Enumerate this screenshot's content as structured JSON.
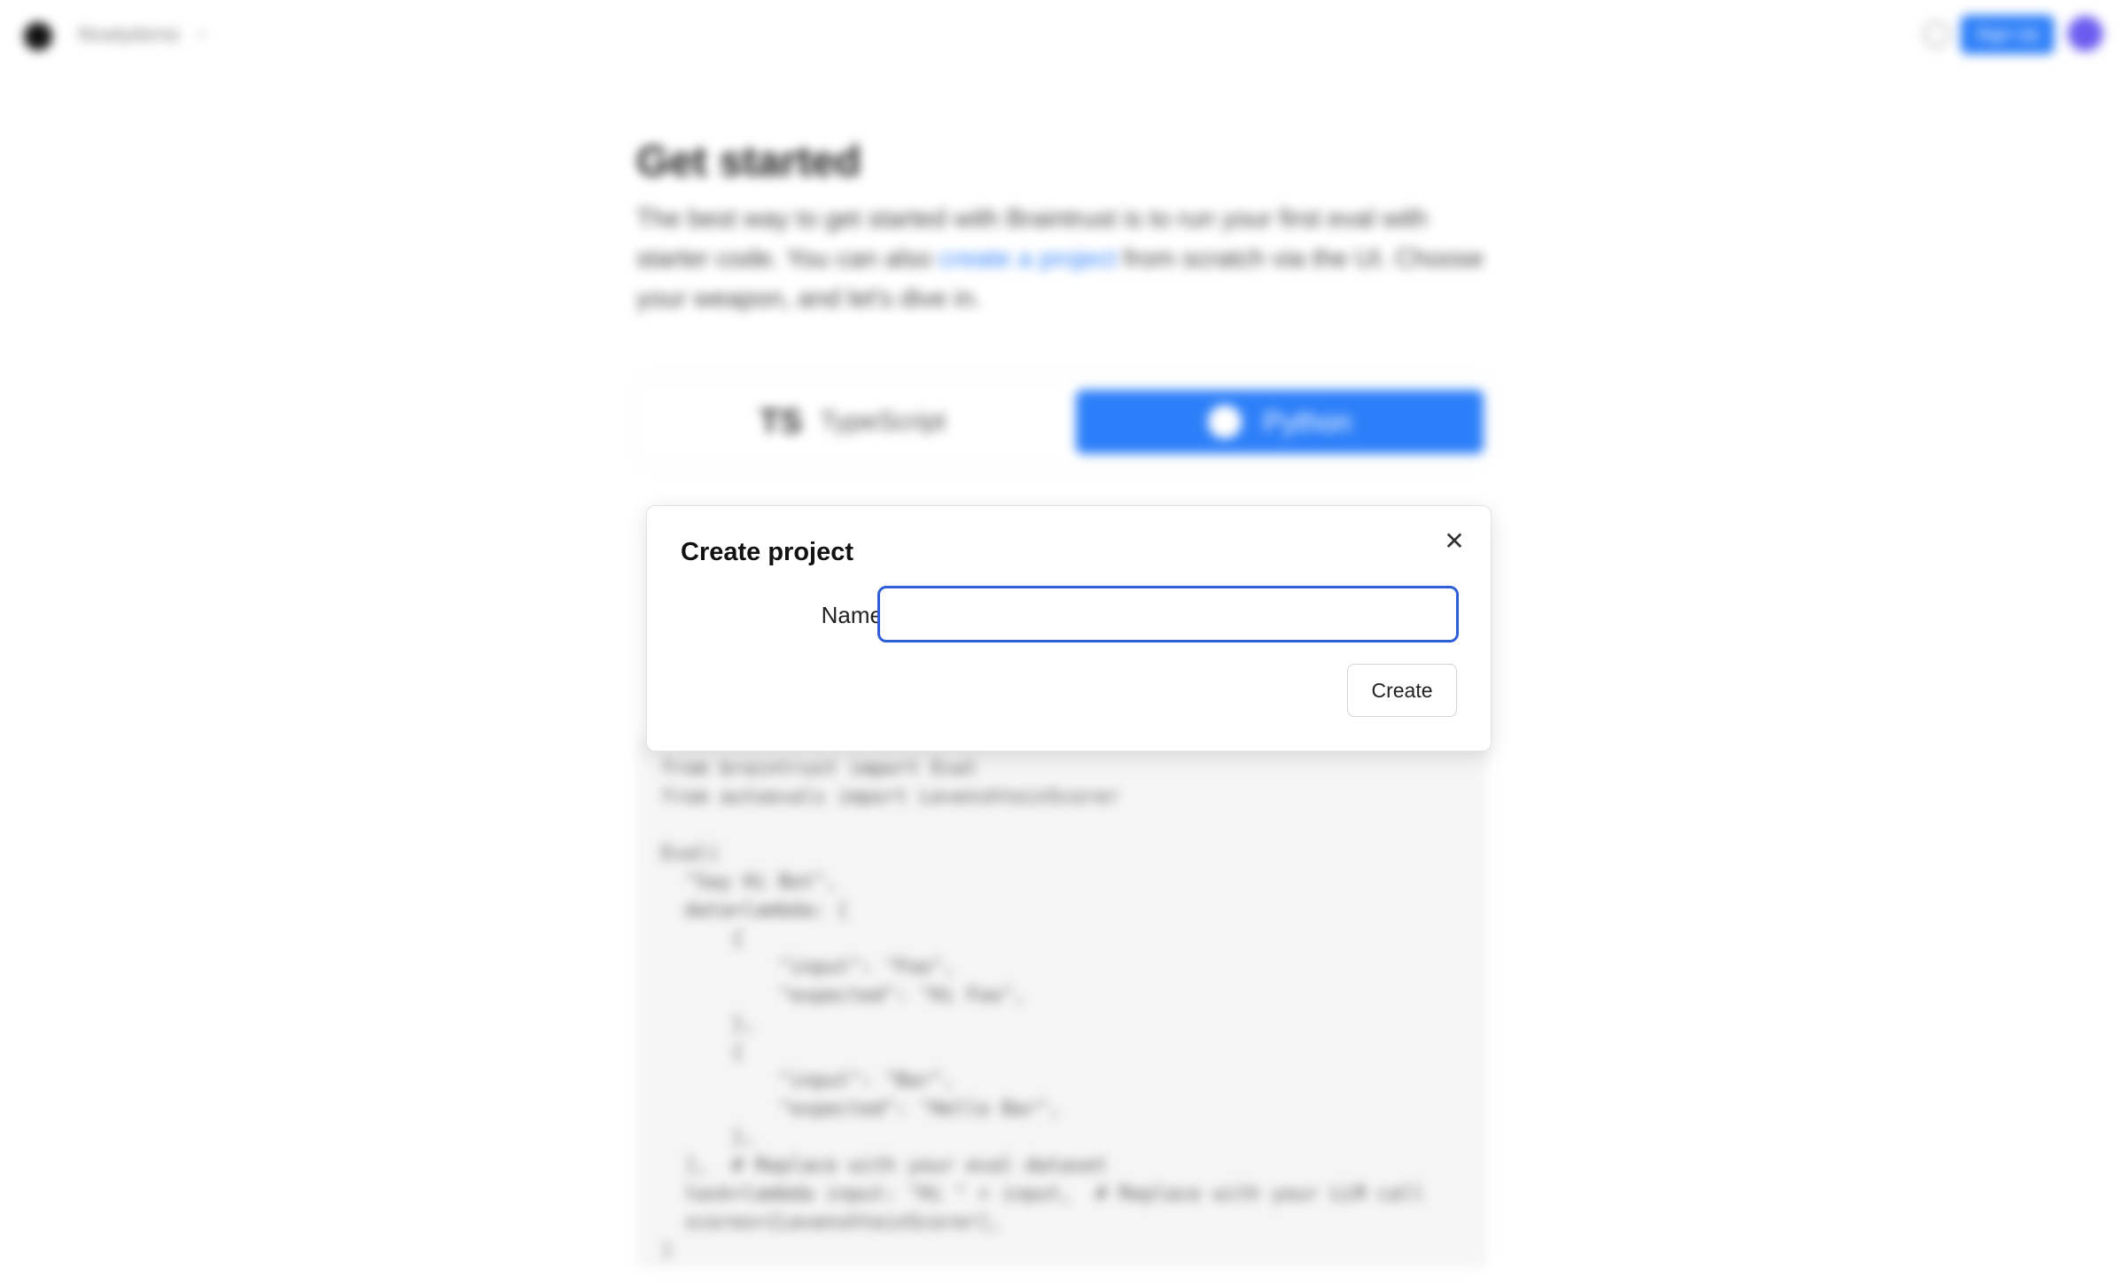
{
  "topbar": {
    "org_name": "Ncwtydsrno",
    "signup_label": "Sign Up"
  },
  "page": {
    "title": "Get started",
    "intro_before": "The best way to get started with Braintrust is to run your first eval with starter code. You can also ",
    "intro_link": "create a project",
    "intro_after": " from scratch via the UI. Choose your weapon, and let's dive in.",
    "languages": [
      {
        "badge": "TS",
        "label": "TypeScript",
        "selected": false
      },
      {
        "label": "Python",
        "selected": true
      }
    ],
    "code_lines": [
      "from braintrust import Eval",
      "from autoevals import LevenshteinScorer",
      "",
      "Eval(",
      "  \"Say Hi Bot\",",
      "  data=lambda: [",
      "      {",
      "          \"input\": \"Foo\",",
      "          \"expected\": \"Hi Foo\",",
      "      },",
      "      {",
      "          \"input\": \"Bar\",",
      "          \"expected\": \"Hello Bar\",",
      "      },",
      "  ],  # Replace with your eval dataset",
      "  task=lambda input: \"Hi \" + input,  # Replace with your LLM call",
      "  scores=[LevenshteinScorer],",
      ")"
    ]
  },
  "modal": {
    "title": "Create project",
    "name_label": "Name",
    "name_value": "",
    "create_label": "Create",
    "close_icon": "close-icon"
  },
  "colors": {
    "accent": "#2d7ff9",
    "input_focus_border": "#2f5fd6"
  }
}
